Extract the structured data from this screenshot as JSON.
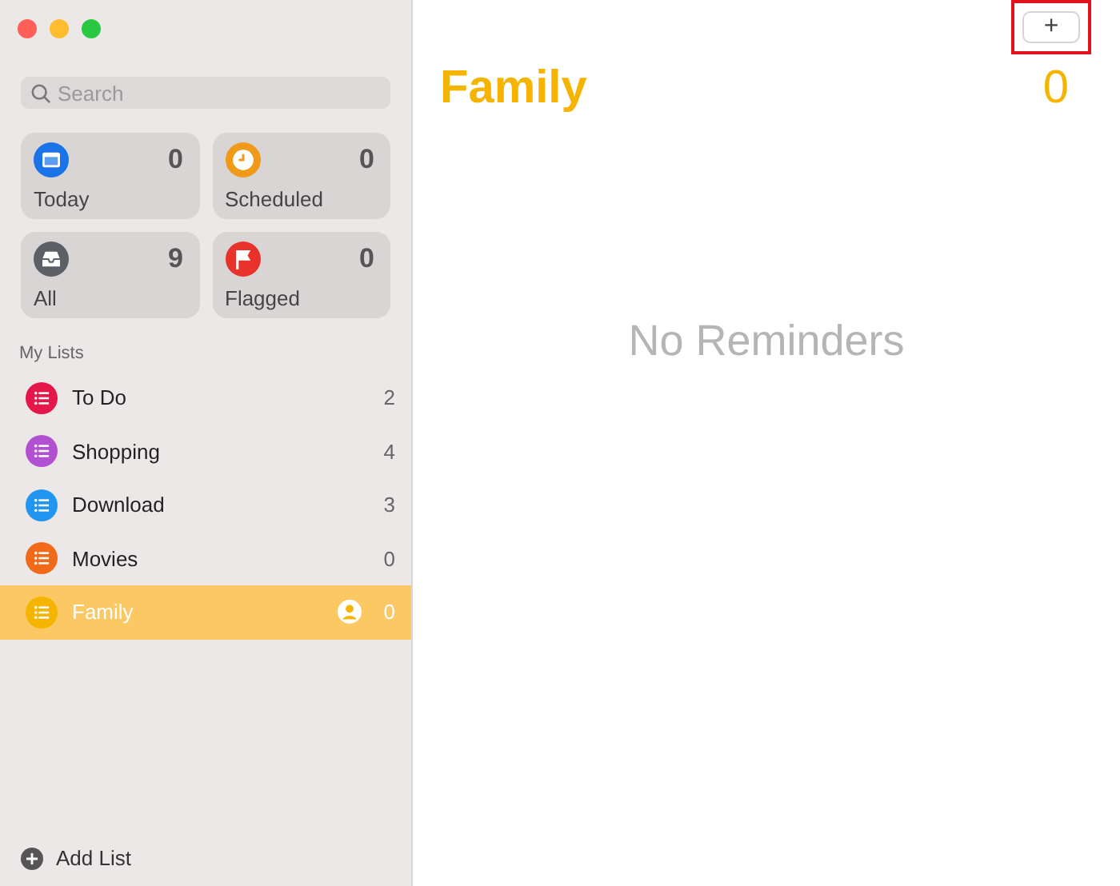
{
  "search": {
    "placeholder": "Search"
  },
  "smart_lists": [
    {
      "kind": "today",
      "label": "Today",
      "count": "0",
      "color": "#1a73e8"
    },
    {
      "kind": "scheduled",
      "label": "Scheduled",
      "count": "0",
      "color": "#f09a1a"
    },
    {
      "kind": "all",
      "label": "All",
      "count": "9",
      "color": "#5b5f66"
    },
    {
      "kind": "flagged",
      "label": "Flagged",
      "count": "0",
      "color": "#e8322b"
    }
  ],
  "my_lists": {
    "heading": "My Lists",
    "items": [
      {
        "name": "To Do",
        "count": "2",
        "color": "#e5174a",
        "selected": false,
        "shared": false
      },
      {
        "name": "Shopping",
        "count": "4",
        "color": "#b150d0",
        "selected": false,
        "shared": false
      },
      {
        "name": "Download",
        "count": "3",
        "color": "#2196f0",
        "selected": false,
        "shared": false
      },
      {
        "name": "Movies",
        "count": "0",
        "color": "#f06a1a",
        "selected": false,
        "shared": false
      },
      {
        "name": "Family",
        "count": "0",
        "color": "#f5b400",
        "selected": true,
        "shared": true
      }
    ]
  },
  "add_list": "Add List",
  "toolbar": {
    "add_button": "+",
    "highlighted": true
  },
  "main": {
    "title": "Family",
    "count": "0",
    "empty_text": "No Reminders"
  }
}
